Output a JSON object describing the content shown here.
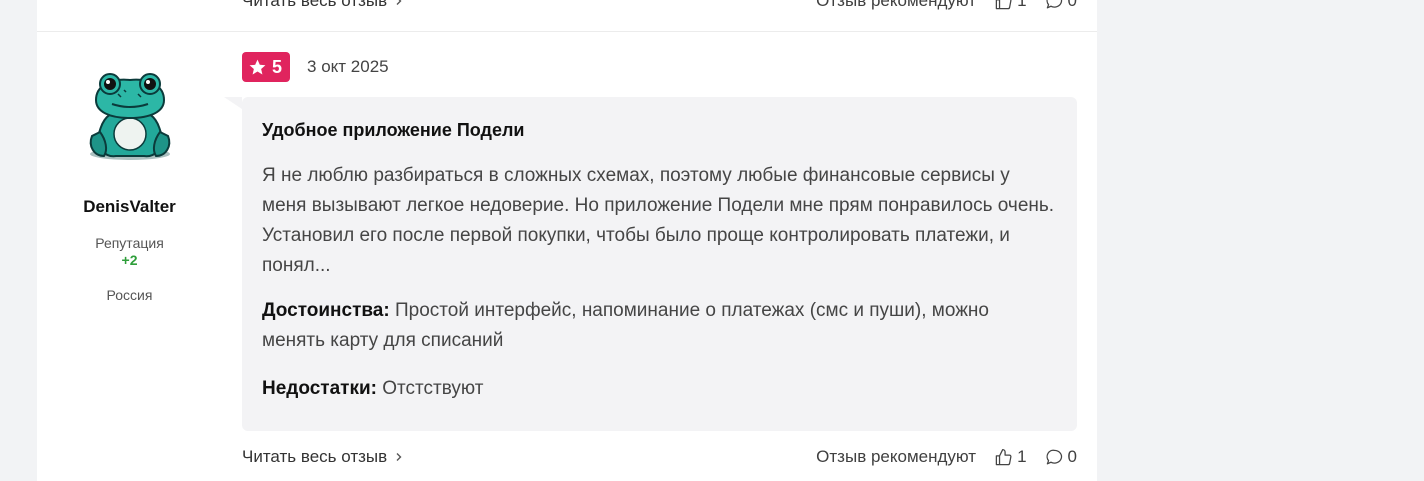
{
  "prev_footer": {
    "read_label": "Читать весь отзыв",
    "recommend_label": "Отзыв рекомендуют",
    "likes": "1",
    "comments": "0"
  },
  "author": {
    "name": "DenisValter",
    "reputation_label": "Репутация",
    "reputation_value": "+2",
    "country": "Россия",
    "avatar_icon": "frog-avatar-icon"
  },
  "review": {
    "rating": "5",
    "date": "3 окт 2025",
    "title": "Удобное приложение Подели",
    "text": "Я не люблю разбираться в сложных схемах, поэтому любые финансовые сервисы у меня вызывают легкое недоверие. Но приложение Подели мне прям понравилось очень. Установил его после первой покупки, чтобы было проще контролировать платежи, и понял...",
    "pros_label": "Достоинства:",
    "pros_text": " Простой интерфейс, напоминание о платежах (смс и пуши), можно менять карту для списаний",
    "cons_label": "Недостатки:",
    "cons_text": " Отстствуют"
  },
  "footer": {
    "read_label": "Читать весь отзыв",
    "recommend_label": "Отзыв рекомендуют",
    "likes": "1",
    "comments": "0"
  },
  "colors": {
    "rating_badge": "#e0245e",
    "reputation_positive": "#2e9e3a",
    "review_bg": "#f3f3f5"
  }
}
